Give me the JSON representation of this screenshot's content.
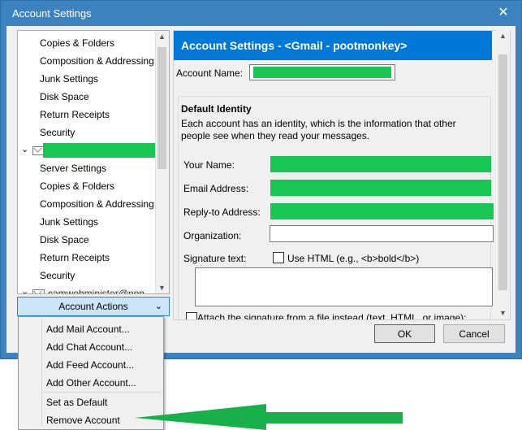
{
  "window": {
    "title": "Account Settings",
    "close_glyph": "✕"
  },
  "tree": {
    "items_top": [
      "Copies & Folders",
      "Composition & Addressing",
      "Junk Settings",
      "Disk Space",
      "Return Receipts",
      "Security"
    ],
    "items_mid": [
      "Server Settings",
      "Copies & Folders",
      "Composition & Addressing",
      "Junk Settings",
      "Disk Space",
      "Return Receipts",
      "Security"
    ],
    "clipped_account": "camwebminister@non"
  },
  "account_actions": {
    "label": "Account Actions",
    "chevron": "⌄"
  },
  "menu": {
    "items": [
      "Add Mail Account...",
      "Add Chat Account...",
      "Add Feed Account...",
      "Add Other Account..."
    ],
    "items2": [
      "Set as Default",
      "Remove Account"
    ]
  },
  "pane": {
    "header": "Account Settings - <Gmail - pootmonkey>",
    "account_name_label": "Account Name:",
    "group_title": "Default Identity",
    "group_desc": "Each account has an identity, which is the information that other people see when they read your messages.",
    "your_name_label": "Your Name:",
    "email_label": "Email Address:",
    "reply_to_label": "Reply-to Address:",
    "organization_label": "Organization:",
    "signature_label": "Signature text:",
    "use_html_label": "Use HTML (e.g., <b>bold</b>)",
    "attach_label": "Attach the signature from a file instead (text, HTML, or image):"
  },
  "buttons": {
    "ok": "OK",
    "cancel": "Cancel"
  },
  "colors": {
    "titlebar": "#3b82bf",
    "header": "#0078d7",
    "redaction": "#17c653",
    "arrow": "#17b04a"
  }
}
